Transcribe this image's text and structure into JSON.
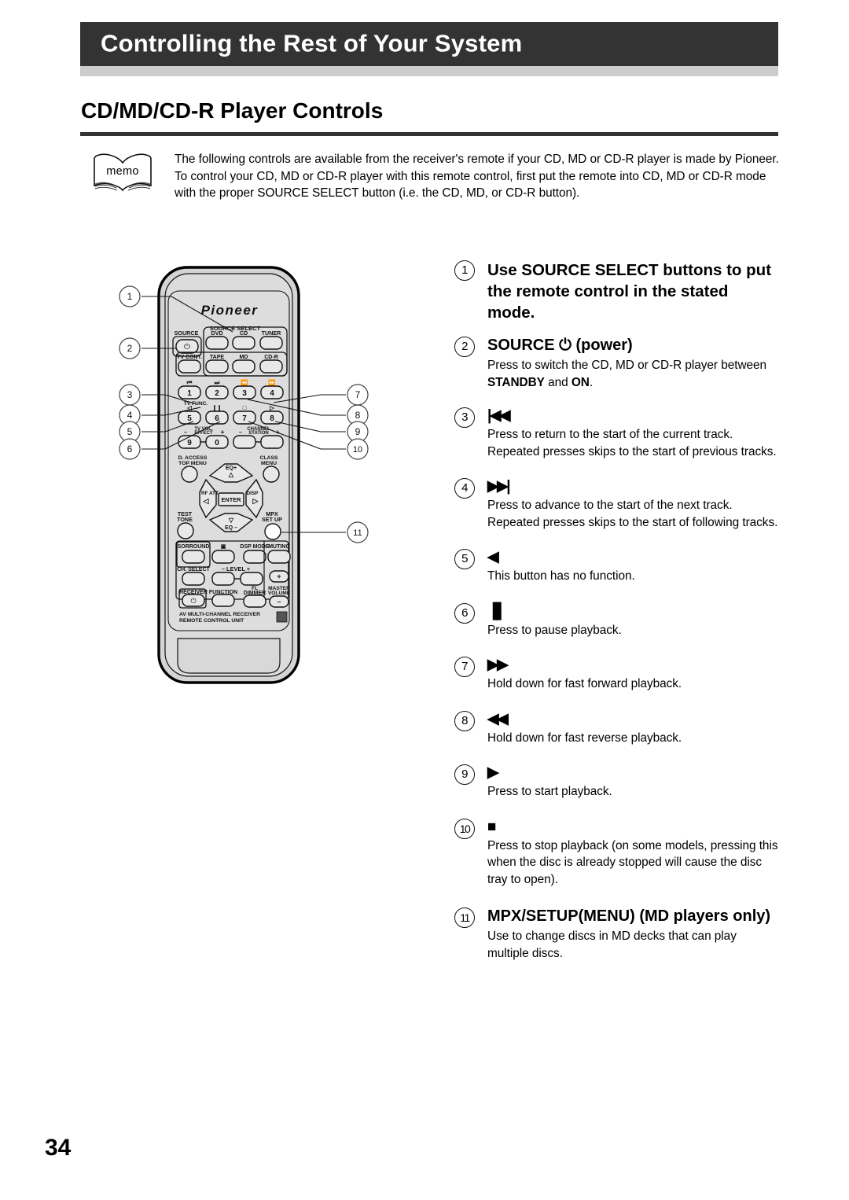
{
  "header": {
    "title": "Controlling the Rest of Your System"
  },
  "section": {
    "title": "CD/MD/CD-R Player Controls"
  },
  "memo": {
    "icon_label": "memo",
    "paragraph1": "The following controls are available from the receiver's remote if your CD, MD or CD-R player is made by Pioneer.",
    "paragraph2": "To control your CD, MD or CD-R player with this remote control, first put the remote into CD, MD or CD-R mode with the proper SOURCE SELECT button (i.e. the CD, MD, or CD-R button)."
  },
  "remote": {
    "brand": "Pioneer",
    "source_select_label": "SOURCE SELECT",
    "source_label": "SOURCE",
    "source_row1": [
      "DVD",
      "CD",
      "TUNER"
    ],
    "source_row2": [
      "TV CONT.",
      "TAPE",
      "MD",
      "CD-R"
    ],
    "numpad": {
      "transport_top": [
        "|◀◀",
        "▶▶|",
        "◀◀",
        "▶▶"
      ],
      "row1": [
        "1",
        "2",
        "3",
        "4"
      ],
      "tv_func_label": "TV FUNC.",
      "transport_mid": [
        "◁",
        "▐▌",
        "□",
        "▷"
      ],
      "row2": [
        "5",
        "6",
        "7",
        "8"
      ],
      "row3": [
        "9",
        "0"
      ],
      "tv_vol_effect": "TV VOL.\nEFFECT",
      "channel_station": "CHANNEL\nSTATION",
      "minus": "–",
      "plus": "+"
    },
    "menus": {
      "d_access": "D. ACCESS",
      "top_menu": "TOP MENU",
      "class": "CLASS",
      "menu": "MENU",
      "eq_plus": "EQ+",
      "eq_minus": "EQ –",
      "rf_att": "RF ATT",
      "disp": "DISP",
      "enter": "ENTER",
      "test": "TEST",
      "tone": "TONE",
      "mpx": "MPX",
      "set_up": "SET UP"
    },
    "bottom_rows": {
      "sorround": "SORROUND",
      "dsp_mode": "DSP MODE",
      "muting": "MUTING",
      "ch_select": "CH. SELECT",
      "level": "LEVEL",
      "receiver": "RECEIVER",
      "function": "FUNCTION",
      "fl": "FL",
      "dimmer": "DIMMER",
      "master": "MASTER",
      "volume": "VOLUME",
      "minus": "–",
      "plus": "+"
    },
    "footer_line1": "AV MULTI-CHANNEL RECEIVER",
    "footer_line2": "REMOTE  CONTROL  UNIT",
    "callouts_left": [
      "1",
      "2",
      "3",
      "4",
      "5",
      "6"
    ],
    "callouts_right": [
      "7",
      "8",
      "9",
      "10",
      "11"
    ]
  },
  "controls": [
    {
      "num": "1",
      "head": "Use SOURCE SELECT buttons to put the remote control in the stated mode.",
      "body": ""
    },
    {
      "num": "2",
      "head": "SOURCE ⏻ (power)",
      "body_html": "Press to switch the CD, MD or CD-R player between <b>STANDBY</b> and <b>ON</b>."
    },
    {
      "num": "3",
      "glyph": "|◀◀",
      "body": "Press to return to the start of the current track. Repeated presses skips to the start of previous tracks."
    },
    {
      "num": "4",
      "glyph": "▶▶|",
      "body": "Press to advance to the start of the next track. Repeated presses skips to the start of following tracks."
    },
    {
      "num": "5",
      "glyph": "◀",
      "body": "This button has no function."
    },
    {
      "num": "6",
      "glyph": "▐▌",
      "body": "Press to pause playback."
    },
    {
      "num": "7",
      "glyph": "▶▶",
      "body": "Hold down for fast forward playback."
    },
    {
      "num": "8",
      "glyph": "◀◀",
      "body": "Hold down for fast reverse playback."
    },
    {
      "num": "9",
      "glyph": "▶",
      "body": "Press to start playback."
    },
    {
      "num": "10",
      "glyph": "■",
      "body": "Press to stop playback (on some models, pressing this when the disc is already stopped will cause the disc tray to open)."
    },
    {
      "num": "11",
      "head": "MPX/SETUP(MENU) (MD players only)",
      "body": "Use to change discs in MD decks that can play multiple discs."
    }
  ],
  "page_number": "34",
  "colors": {
    "header_bar": "#333333",
    "header_underbar": "#cccccc",
    "rule": "#333333",
    "remote_body": "#d4d4d4",
    "remote_panel": "#d9d9d9"
  }
}
